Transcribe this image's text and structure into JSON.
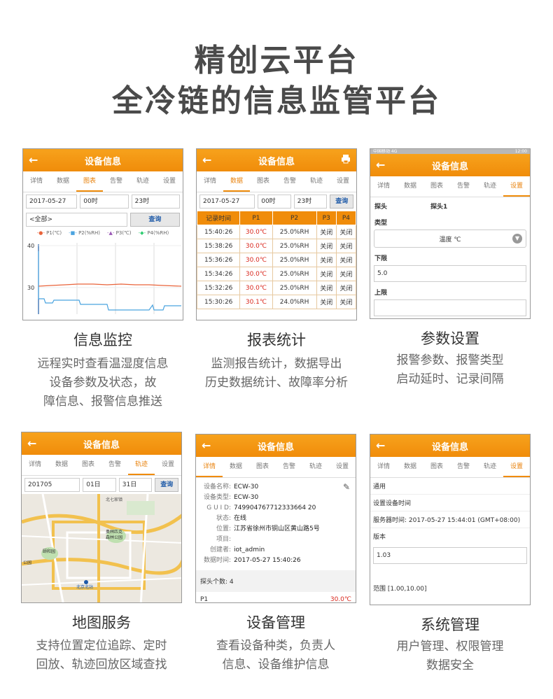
{
  "header": {
    "line1": "精创云平台",
    "line2": "全冷链的信息监管平台"
  },
  "common": {
    "appbar_title": "设备信息",
    "tabs": [
      "详情",
      "数据",
      "图表",
      "告警",
      "轨迹",
      "设置"
    ]
  },
  "cards": [
    {
      "caption": "信息监控",
      "desc": [
        "远程实时查看温湿度信息",
        "设备参数及状态，故",
        "障信息、报警信息推送"
      ],
      "date": "2017-05-27",
      "from": "00时",
      "to": "23时",
      "scope": "<全部>",
      "query": "查询",
      "legend": [
        "P1(℃)",
        "P2(%RH)",
        "P3(℃)",
        "P4(%RH)"
      ],
      "y_ticks": [
        "40",
        "30"
      ]
    },
    {
      "caption": "报表统计",
      "desc": [
        "监测报告统计，数据导出",
        "历史数据统计、故障率分析"
      ],
      "date": "2017-05-27",
      "from": "00时",
      "to": "23时",
      "query": "查询",
      "columns": [
        "记录时间",
        "P1",
        "P2",
        "P3",
        "P4"
      ],
      "rows": [
        [
          "15:40:26",
          "30.0℃",
          "25.0%RH",
          "关闭",
          "关闭"
        ],
        [
          "15:38:26",
          "30.0℃",
          "25.0%RH",
          "关闭",
          "关闭"
        ],
        [
          "15:36:26",
          "30.0℃",
          "25.0%RH",
          "关闭",
          "关闭"
        ],
        [
          "15:34:26",
          "30.0℃",
          "25.0%RH",
          "关闭",
          "关闭"
        ],
        [
          "15:32:26",
          "30.0℃",
          "25.0%RH",
          "关闭",
          "关闭"
        ],
        [
          "15:30:26",
          "30.1℃",
          "24.0%RH",
          "关闭",
          "关闭"
        ]
      ]
    },
    {
      "caption": "参数设置",
      "desc": [
        "报警参数、报警类型",
        "启动延时、记录间隔"
      ],
      "status_left": "中国移动 4G",
      "status_right": "12:00",
      "probe_label": "探头",
      "probe_value": "探头1",
      "type_label": "类型",
      "type_value": "温度 ℃",
      "lower_label": "下限",
      "lower_value": "5.0",
      "upper_label": "上限"
    },
    {
      "caption": "地图服务",
      "desc": [
        "支持位置定位追踪、定时",
        "回放、轨迹回放区域查找"
      ],
      "date": "201705",
      "from": "01日",
      "to": "31日",
      "query": "查询",
      "map_labels": [
        "北七家镇",
        "奥林匹克",
        "森林公园",
        "颐和园",
        "公园",
        "北京北站"
      ]
    },
    {
      "caption": "设备管理",
      "desc": [
        "查看设备种类，负责人",
        "信息、设备维护信息"
      ],
      "info": [
        [
          "设备名称:",
          "ECW-30"
        ],
        [
          "设备类型:",
          "ECW-30"
        ],
        [
          "G U I D:",
          "749904767712333664 20"
        ],
        [
          "状态:",
          "在线"
        ],
        [
          "位置:",
          "江苏省徐州市铜山区黄山路5号"
        ],
        [
          "项目:",
          ""
        ],
        [
          "创建者:",
          "iot_admin"
        ],
        [
          "数据时间:",
          "2017-05-27 15:40:26"
        ]
      ],
      "probe_count": "探头个数: 4",
      "p1_label": "P1",
      "p1_value": "30.0℃"
    },
    {
      "caption": "系统管理",
      "desc": [
        "用户管理、权限管理",
        "数据安全"
      ],
      "general": "通用",
      "set_time": "设置设备时间",
      "server_time": "服务器时间: 2017-05-27 15:44:01 (GMT+08:00)",
      "version_label": "版本",
      "version_value": "1.03",
      "range": "范围 [1.00,10.00]"
    }
  ],
  "colors": {
    "accent": "#f08c0a",
    "alarm_red": "#d9261c",
    "p1_line": "#e9633a",
    "p2_line": "#4aa3df"
  }
}
